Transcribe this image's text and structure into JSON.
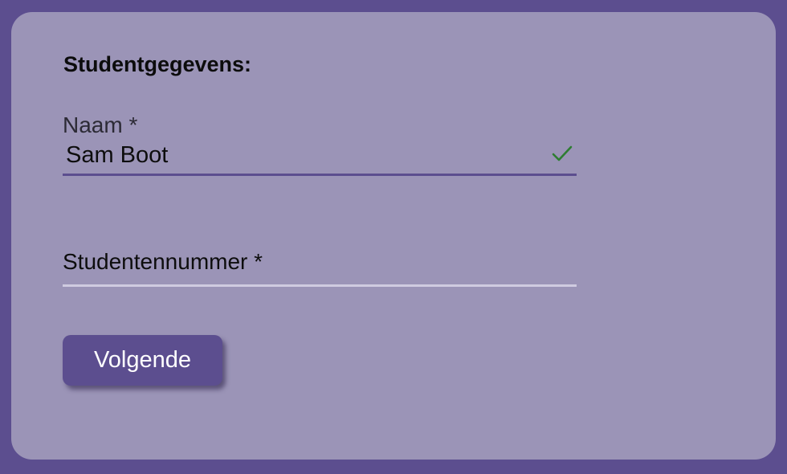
{
  "form": {
    "heading": "Studentgegevens:",
    "name_field": {
      "label": "Naam *",
      "value": "Sam Boot",
      "valid_icon": "check-icon"
    },
    "student_number_field": {
      "placeholder": "Studentennummer *",
      "value": ""
    },
    "next_button_label": "Volgende"
  },
  "colors": {
    "page_background": "#5c4e8f",
    "card_background": "#9b94b7",
    "accent": "#5c4e8f",
    "valid_check": "#2e7d32"
  }
}
